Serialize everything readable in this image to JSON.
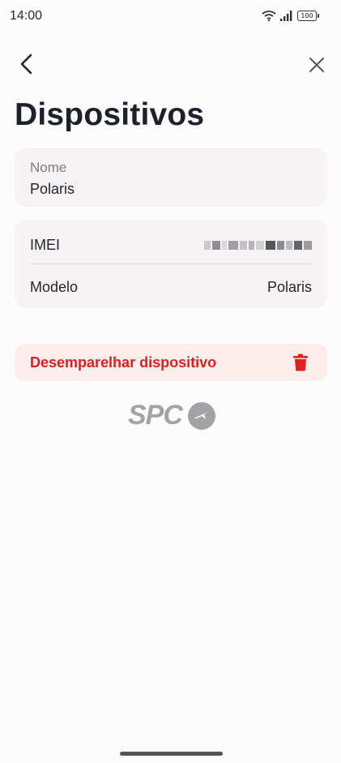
{
  "status_bar": {
    "time": "14:00",
    "battery": "100"
  },
  "header": {
    "title": "Dispositivos"
  },
  "name_card": {
    "label": "Nome",
    "value": "Polaris"
  },
  "info": {
    "imei_label": "IMEI",
    "model_label": "Modelo",
    "model_value": "Polaris"
  },
  "unpair": {
    "label": "Desemparelhar dispositivo"
  },
  "logo": {
    "text": "SPC"
  },
  "colors": {
    "danger": "#e0201e",
    "card_bg": "#f7f3f4",
    "danger_bg": "#fdeeee"
  },
  "icons": [
    "wifi-icon",
    "signal-icon",
    "battery-icon",
    "back-icon",
    "close-icon",
    "trash-icon",
    "spc-logo-icon"
  ]
}
